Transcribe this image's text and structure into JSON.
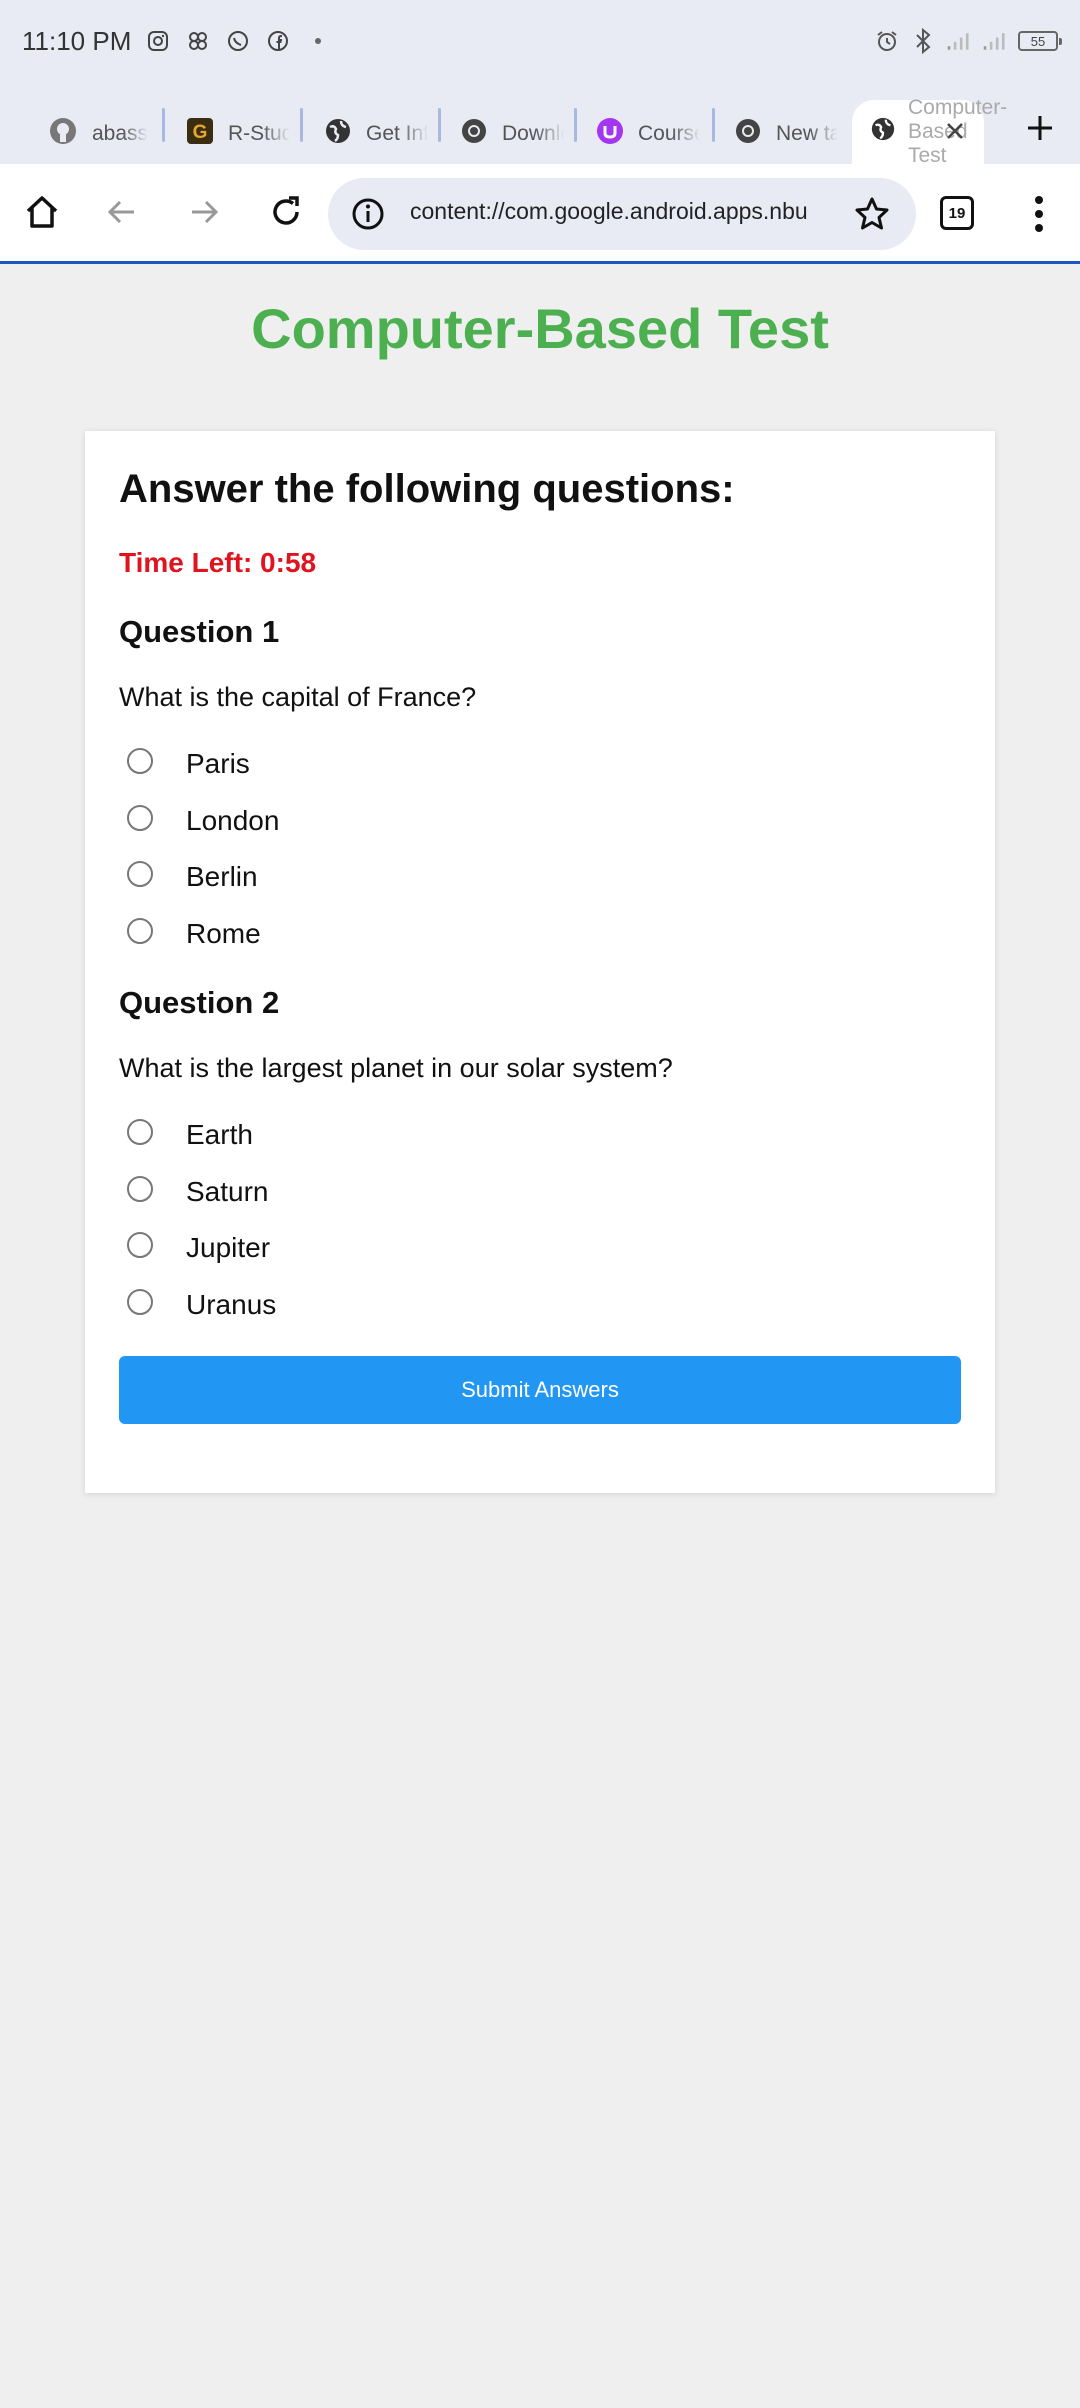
{
  "status_bar": {
    "time": "11:10 PM",
    "battery": "55"
  },
  "tabs": [
    {
      "label": "abass",
      "icon": "github-icon"
    },
    {
      "label": "R-Studio",
      "icon": "grammarly-icon"
    },
    {
      "label": "Get Info",
      "icon": "globe-icon"
    },
    {
      "label": "Download",
      "icon": "chrome-icon"
    },
    {
      "label": "Course",
      "icon": "udemy-icon"
    },
    {
      "label": "New tab",
      "icon": "chrome-icon"
    }
  ],
  "active_tab": {
    "label": "Computer-Based Test",
    "icon": "globe-icon"
  },
  "toolbar": {
    "url": "content://com.google.android.apps.nbu",
    "tab_count": "19"
  },
  "page": {
    "title": "Computer-Based Test",
    "heading": "Answer the following questions:",
    "timer": "Time Left: 0:58",
    "submit_label": "Submit Answers",
    "title_color": "#4caf50",
    "timer_color": "#e0141e",
    "button_color": "#2196f3"
  },
  "questions": [
    {
      "title": "Question 1",
      "text": "What is the capital of France?",
      "options": [
        "Paris",
        "London",
        "Berlin",
        "Rome"
      ]
    },
    {
      "title": "Question 2",
      "text": "What is the largest planet in our solar system?",
      "options": [
        "Earth",
        "Saturn",
        "Jupiter",
        "Uranus"
      ]
    }
  ]
}
